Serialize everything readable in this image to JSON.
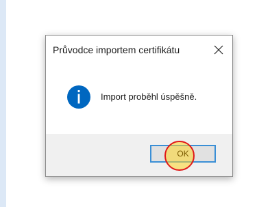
{
  "dialog": {
    "title": "Průvodce importem certifikátu",
    "close_symbol": "✕",
    "message": "Import proběhl úspěšně.",
    "icon": "info-icon",
    "ok_label": "OK"
  },
  "colors": {
    "accent": "#0067c0",
    "focus_border": "#3a8fd6",
    "click_marker_fill": "#ffd628",
    "click_marker_ring": "#e01818"
  }
}
